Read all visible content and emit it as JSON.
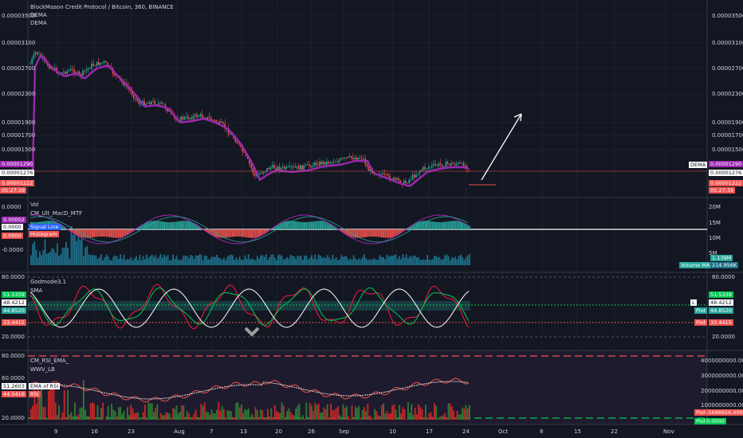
{
  "header": {
    "title": "BlockMason Credit Protocol / Bitcoin, 360, BINANCE",
    "ind1": "DEMA",
    "ind2": "DEMA"
  },
  "colors": {
    "bg": "#131722",
    "grid": "#1e222d",
    "up": "#26a69a",
    "down": "#ef5350",
    "dema": "#9c27b0",
    "macd_hist_up": "#26a69a",
    "macd_hist_dn": "#ef5350",
    "volume": "#1d6f8a",
    "rsi_bg": "#2a1f3a",
    "stoch_main": "#ff1744",
    "stoch_sig": "#00c853",
    "white": "#ffffff"
  },
  "x_axis": {
    "labels": [
      "9",
      "16",
      "23",
      "Aug",
      "7",
      "13",
      "20",
      "26",
      "Sep",
      "10",
      "17",
      "24",
      "Oct",
      "8",
      "15",
      "22",
      "Nov"
    ]
  },
  "pane1": {
    "left_ticks": [
      "0.00003500",
      "0.00003100",
      "0.00002700",
      "0.00002300",
      "0.00001900",
      "0.00001700",
      "0.00001500",
      "0.00001290",
      "0.00001276",
      "0.00001222",
      "05:27:39"
    ],
    "right_ticks": [
      "0.00003500",
      "0.00003100",
      "0.00002700",
      "0.00002300",
      "0.00001900",
      "0.00001700",
      "0.00001500"
    ],
    "dema_label": "DEMA",
    "right_tags": [
      "0.00001290",
      "0.00001276",
      "0.00001222",
      "05:27:39"
    ]
  },
  "pane2": {
    "title1": "Vol",
    "title2": "CM_Ult_MacD_MTF",
    "left_ticks": [
      "0.0000",
      "0.00002",
      "0.0000",
      "0.0000",
      "-0.0000"
    ],
    "signal_label": "Signal Line",
    "histogram_label": "Histogram",
    "right_ticks": [
      "20M",
      "15M",
      "10M",
      "5M"
    ],
    "volume_tags": [
      "1.139M",
      "Volume MA",
      "214.956K"
    ]
  },
  "pane3": {
    "title1": "Godmode3.1",
    "title2": "SMA",
    "left_ticks": [
      "80.0000",
      "51.5339",
      "48.4212",
      "44.8520",
      "33.4415",
      "20.0000"
    ],
    "right_ticks": [
      "80.0000",
      "51.5339",
      "48.4212",
      "44.8520",
      "33.4415",
      "20.0000"
    ],
    "right_tag_labels": [
      "L",
      "Plot",
      "Plot"
    ]
  },
  "pane4": {
    "title1": "CM_RSI_EMA_",
    "title2": "WWV_LB",
    "left_ticks": [
      "80.0000",
      "60.0000",
      "51.2603",
      "44.5416",
      "20.0000"
    ],
    "ema_rsi_label": "EMA of RSI",
    "rsi_label": "RSI",
    "right_ticks": [
      "4000000000.0000",
      "3000000000.0000",
      "2000000000.0000",
      "1000000000.0000"
    ],
    "right_tags": [
      "-5696656.0000",
      "0.0000"
    ],
    "plot_label": "Plot"
  }
}
